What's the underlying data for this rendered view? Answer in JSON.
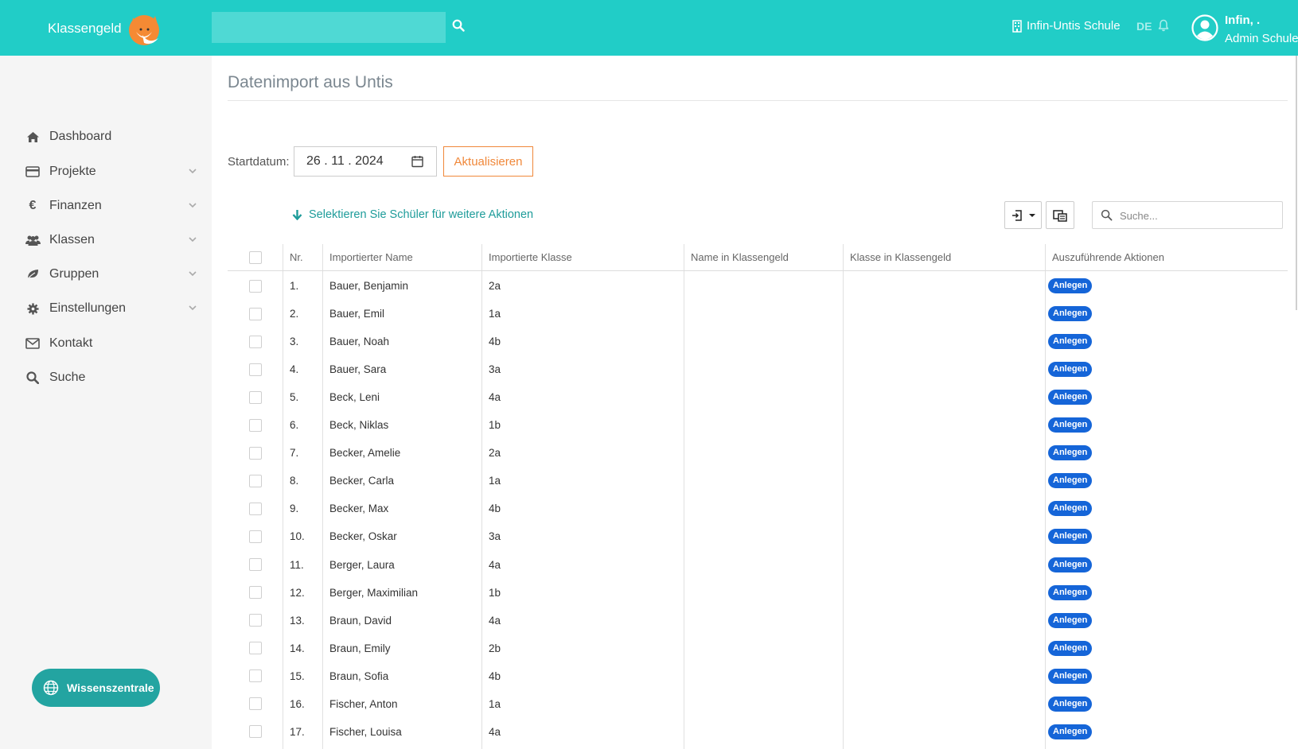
{
  "header": {
    "brand": "Klassengeld",
    "search_placeholder": "",
    "school": "Infin-Untis Schule",
    "language": "DE",
    "user_name": "Infin, .",
    "user_role": "Admin Schule"
  },
  "sidebar": {
    "items": [
      {
        "label": "Dashboard",
        "icon": "home-icon",
        "expandable": false
      },
      {
        "label": "Projekte",
        "icon": "credit-card-icon",
        "expandable": true
      },
      {
        "label": "Finanzen",
        "icon": "euro-icon",
        "expandable": true
      },
      {
        "label": "Klassen",
        "icon": "users-icon",
        "expandable": true
      },
      {
        "label": "Gruppen",
        "icon": "leaf-icon",
        "expandable": true
      },
      {
        "label": "Einstellungen",
        "icon": "gear-icon",
        "expandable": true
      },
      {
        "label": "Kontakt",
        "icon": "envelope-icon",
        "expandable": false
      },
      {
        "label": "Suche",
        "icon": "search-icon",
        "expandable": false
      }
    ],
    "wissen_label": "Wissenszentrale"
  },
  "main": {
    "title": "Datenimport aus Untis",
    "start_label": "Startdatum:",
    "start_date": "26 . 11 . 2024",
    "refresh_label": "Aktualisieren",
    "select_hint": "Selektieren Sie Schüler für weitere Aktionen",
    "table_search_placeholder": "Suche..."
  },
  "table": {
    "columns": [
      "Nr.",
      "Importierter Name",
      "Importierte Klasse",
      "Name in Klassengeld",
      "Klasse in Klassengeld",
      "Auszuführende Aktionen"
    ],
    "rows": [
      {
        "nr": "1.",
        "name": "Bauer, Benjamin",
        "klasse": "2a",
        "kg_name": "",
        "kg_klasse": "",
        "action": "Anlegen"
      },
      {
        "nr": "2.",
        "name": "Bauer, Emil",
        "klasse": "1a",
        "kg_name": "",
        "kg_klasse": "",
        "action": "Anlegen"
      },
      {
        "nr": "3.",
        "name": "Bauer, Noah",
        "klasse": "4b",
        "kg_name": "",
        "kg_klasse": "",
        "action": "Anlegen"
      },
      {
        "nr": "4.",
        "name": "Bauer, Sara",
        "klasse": "3a",
        "kg_name": "",
        "kg_klasse": "",
        "action": "Anlegen"
      },
      {
        "nr": "5.",
        "name": "Beck, Leni",
        "klasse": "4a",
        "kg_name": "",
        "kg_klasse": "",
        "action": "Anlegen"
      },
      {
        "nr": "6.",
        "name": "Beck, Niklas",
        "klasse": "1b",
        "kg_name": "",
        "kg_klasse": "",
        "action": "Anlegen"
      },
      {
        "nr": "7.",
        "name": "Becker, Amelie",
        "klasse": "2a",
        "kg_name": "",
        "kg_klasse": "",
        "action": "Anlegen"
      },
      {
        "nr": "8.",
        "name": "Becker, Carla",
        "klasse": "1a",
        "kg_name": "",
        "kg_klasse": "",
        "action": "Anlegen"
      },
      {
        "nr": "9.",
        "name": "Becker, Max",
        "klasse": "4b",
        "kg_name": "",
        "kg_klasse": "",
        "action": "Anlegen"
      },
      {
        "nr": "10.",
        "name": "Becker, Oskar",
        "klasse": "3a",
        "kg_name": "",
        "kg_klasse": "",
        "action": "Anlegen"
      },
      {
        "nr": "11.",
        "name": "Berger, Laura",
        "klasse": "4a",
        "kg_name": "",
        "kg_klasse": "",
        "action": "Anlegen"
      },
      {
        "nr": "12.",
        "name": "Berger, Maximilian",
        "klasse": "1b",
        "kg_name": "",
        "kg_klasse": "",
        "action": "Anlegen"
      },
      {
        "nr": "13.",
        "name": "Braun, David",
        "klasse": "4a",
        "kg_name": "",
        "kg_klasse": "",
        "action": "Anlegen"
      },
      {
        "nr": "14.",
        "name": "Braun, Emily",
        "klasse": "2b",
        "kg_name": "",
        "kg_klasse": "",
        "action": "Anlegen"
      },
      {
        "nr": "15.",
        "name": "Braun, Sofia",
        "klasse": "4b",
        "kg_name": "",
        "kg_klasse": "",
        "action": "Anlegen"
      },
      {
        "nr": "16.",
        "name": "Fischer, Anton",
        "klasse": "1a",
        "kg_name": "",
        "kg_klasse": "",
        "action": "Anlegen"
      },
      {
        "nr": "17.",
        "name": "Fischer, Louisa",
        "klasse": "4a",
        "kg_name": "",
        "kg_klasse": "",
        "action": "Anlegen"
      }
    ]
  },
  "colors": {
    "header_bg": "#21cdc7",
    "accent_teal": "#1e9c9a",
    "orange": "#f0883a",
    "badge_blue": "#1565d8"
  }
}
